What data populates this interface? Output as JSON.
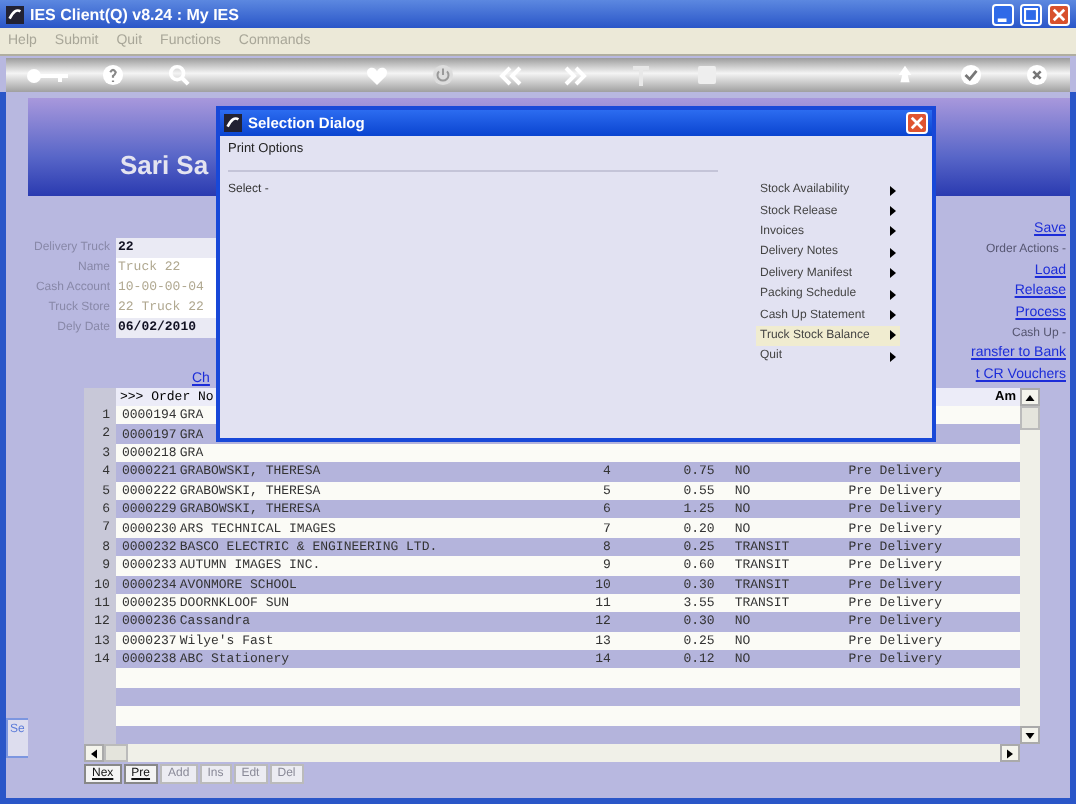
{
  "window": {
    "title": "IES Client(Q) v8.24 : My IES"
  },
  "menu": [
    {
      "label": "Help"
    },
    {
      "label": "Submit"
    },
    {
      "label": "Quit"
    },
    {
      "label": "Functions"
    },
    {
      "label": "Commands"
    }
  ],
  "header": {
    "title": "Sari Sa"
  },
  "form": [
    {
      "label": "Delivery Truck",
      "value": "22",
      "kind": "plain"
    },
    {
      "label": "Name",
      "value": "Truck 22",
      "kind": "readonly"
    },
    {
      "label": "Cash Account",
      "value": "10-00-00-04",
      "kind": "readonly"
    },
    {
      "label": "Truck Store",
      "value": "22 Truck 22",
      "kind": "readonly"
    },
    {
      "label": "Dely Date",
      "value": "06/02/2010",
      "kind": "plain"
    }
  ],
  "left_link": "Ch",
  "actions": [
    {
      "text": "Save",
      "kind": "link"
    },
    {
      "text": "Order Actions -",
      "kind": "label"
    },
    {
      "text": "Load",
      "kind": "link"
    },
    {
      "text": "Release",
      "kind": "link"
    },
    {
      "text": "Process",
      "kind": "link"
    },
    {
      "text": "Cash Up -",
      "kind": "label"
    },
    {
      "text": "ransfer to Bank",
      "kind": "link"
    },
    {
      "text": "t CR Vouchers",
      "kind": "link"
    }
  ],
  "table": {
    "columns": [
      ">>> Order No",
      "Am"
    ],
    "rows": [
      {
        "index": "1",
        "order": "0000194",
        "name": "GRA"
      },
      {
        "index": "2",
        "order": "0000197",
        "name": "GRA"
      },
      {
        "index": "3",
        "order": "0000218",
        "name": "GRA"
      },
      {
        "index": "4",
        "order": "0000221",
        "name": "GRABOWSKI, THERESA",
        "count": "4",
        "amount": "0.75",
        "transit": "NO",
        "status": "Pre Delivery"
      },
      {
        "index": "5",
        "order": "0000222",
        "name": "GRABOWSKI, THERESA",
        "count": "5",
        "amount": "0.55",
        "transit": "NO",
        "status": "Pre Delivery"
      },
      {
        "index": "6",
        "order": "0000229",
        "name": "GRABOWSKI, THERESA",
        "count": "6",
        "amount": "1.25",
        "transit": "NO",
        "status": "Pre Delivery"
      },
      {
        "index": "7",
        "order": "0000230",
        "name": "ARS TECHNICAL IMAGES",
        "count": "7",
        "amount": "0.20",
        "transit": "NO",
        "status": "Pre Delivery"
      },
      {
        "index": "8",
        "order": "0000232",
        "name": "BASCO ELECTRIC & ENGINEERING LTD.",
        "count": "8",
        "amount": "0.25",
        "transit": "TRANSIT",
        "status": "Pre Delivery"
      },
      {
        "index": "9",
        "order": "0000233",
        "name": "AUTUMN IMAGES INC.",
        "count": "9",
        "amount": "0.60",
        "transit": "TRANSIT",
        "status": "Pre Delivery"
      },
      {
        "index": "10",
        "order": "0000234",
        "name": "AVONMORE SCHOOL",
        "count": "10",
        "amount": "0.30",
        "transit": "TRANSIT",
        "status": "Pre Delivery"
      },
      {
        "index": "11",
        "order": "0000235",
        "name": "DOORNKLOOF SUN",
        "count": "11",
        "amount": "3.55",
        "transit": "TRANSIT",
        "status": "Pre Delivery"
      },
      {
        "index": "12",
        "order": "0000236",
        "name": "Cassandra",
        "count": "12",
        "amount": "0.30",
        "transit": "NO",
        "status": "Pre Delivery"
      },
      {
        "index": "13",
        "order": "0000237",
        "name": "Wilye's Fast",
        "count": "13",
        "amount": "0.25",
        "transit": "NO",
        "status": "Pre Delivery"
      },
      {
        "index": "14",
        "order": "0000238",
        "name": "ABC Stationery",
        "count": "14",
        "amount": "0.12",
        "transit": "NO",
        "status": "Pre Delivery"
      }
    ]
  },
  "tabs": [
    {
      "label": "Nex",
      "disabled": false
    },
    {
      "label": "Pre",
      "disabled": false
    },
    {
      "label": "Add",
      "disabled": true
    },
    {
      "label": "Ins",
      "disabled": true
    },
    {
      "label": "Edt",
      "disabled": true
    },
    {
      "label": "Del",
      "disabled": true
    }
  ],
  "side_tab": {
    "label": "Se"
  },
  "dialog": {
    "title": "Selection Dialog",
    "section": "Print Options",
    "prompt": "Select -",
    "items": [
      {
        "label": "Stock Availability",
        "selected": false
      },
      {
        "label": "Stock Release",
        "selected": false
      },
      {
        "label": "Invoices",
        "selected": false
      },
      {
        "label": "Delivery Notes",
        "selected": false
      },
      {
        "label": "Delivery Manifest",
        "selected": false
      },
      {
        "label": "Packing Schedule",
        "selected": false
      },
      {
        "label": "Cash Up Statement",
        "selected": false
      },
      {
        "label": "Truck Stock Balance",
        "selected": true
      },
      {
        "label": "Quit",
        "selected": false
      }
    ]
  }
}
